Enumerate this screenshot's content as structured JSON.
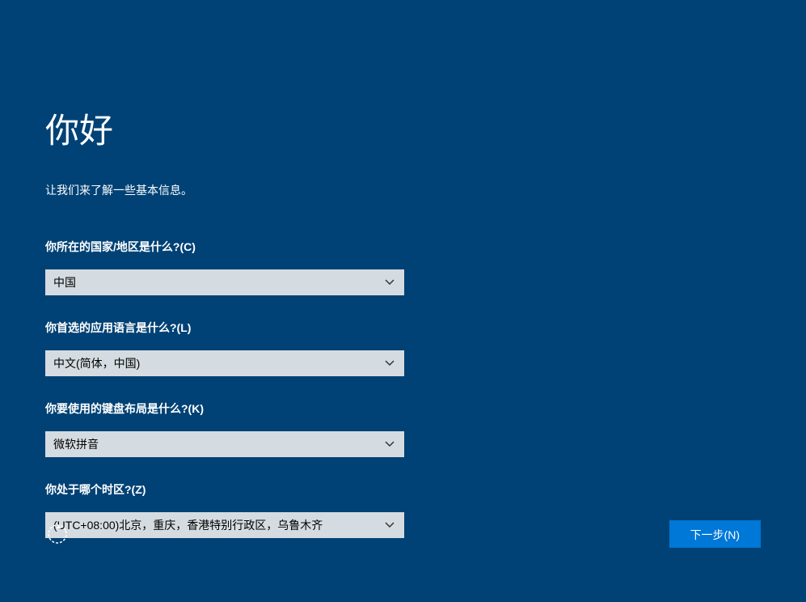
{
  "header": {
    "title": "你好",
    "subtitle": "让我们来了解一些基本信息。"
  },
  "form": {
    "country": {
      "label": "你所在的国家/地区是什么?(C)",
      "value": "中国"
    },
    "language": {
      "label": "你首选的应用语言是什么?(L)",
      "value": "中文(简体，中国)"
    },
    "keyboard": {
      "label": "你要使用的键盘布局是什么?(K)",
      "value": "微软拼音"
    },
    "timezone": {
      "label": "你处于哪个时区?(Z)",
      "value": "(UTC+08:00)北京，重庆，香港特别行政区，乌鲁木齐"
    }
  },
  "footer": {
    "next_button": "下一步(N)"
  }
}
